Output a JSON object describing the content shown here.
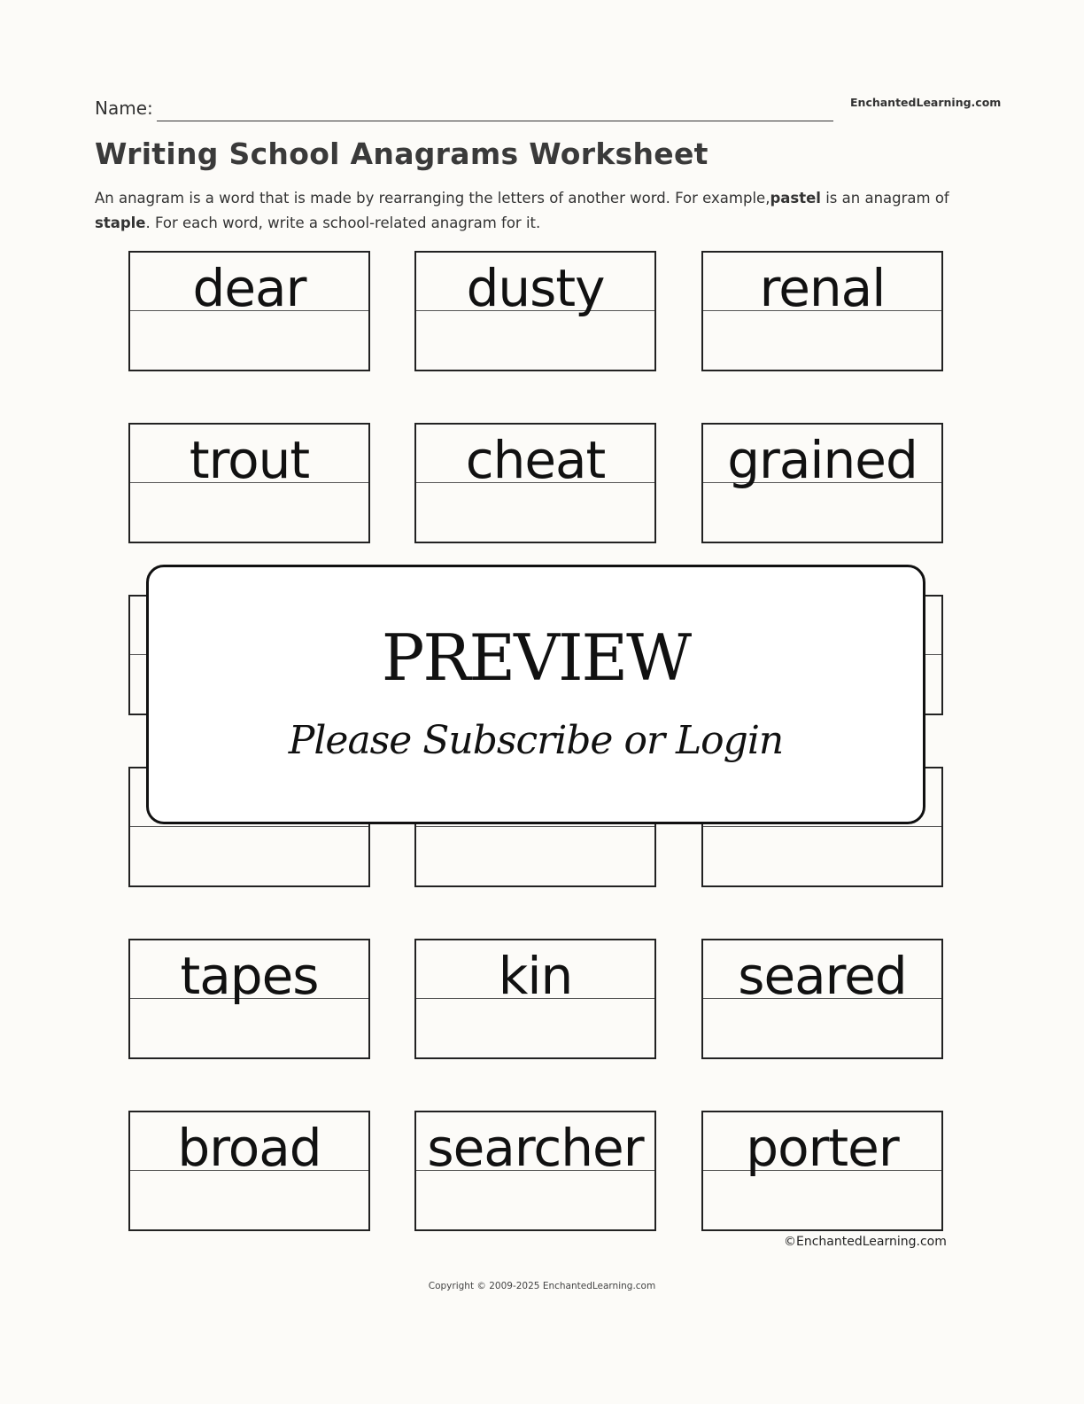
{
  "header": {
    "name_label": "Name:",
    "brand": "EnchantedLearning.com"
  },
  "title": "Writing School Anagrams Worksheet",
  "intro": {
    "part1": "An anagram is a word that is made by rearranging the letters of another word. For example,",
    "example_word": "pastel",
    "part2": " is an anagram of ",
    "example_anagram": "staple",
    "part3": ". For each word, write a school-related anagram for it."
  },
  "words": [
    {
      "word": "dear",
      "answer": ""
    },
    {
      "word": "dusty",
      "answer": ""
    },
    {
      "word": "renal",
      "answer": ""
    },
    {
      "word": "trout",
      "answer": ""
    },
    {
      "word": "cheat",
      "answer": ""
    },
    {
      "word": "grained",
      "answer": ""
    },
    {
      "word": "",
      "answer": ""
    },
    {
      "word": "",
      "answer": ""
    },
    {
      "word": "",
      "answer": ""
    },
    {
      "word": "",
      "answer": ""
    },
    {
      "word": "",
      "answer": ""
    },
    {
      "word": "",
      "answer": ""
    },
    {
      "word": "tapes",
      "answer": ""
    },
    {
      "word": "kin",
      "answer": ""
    },
    {
      "word": "seared",
      "answer": ""
    },
    {
      "word": "broad",
      "answer": ""
    },
    {
      "word": "searcher",
      "answer": ""
    },
    {
      "word": "porter",
      "answer": ""
    }
  ],
  "overlay": {
    "title": "PREVIEW",
    "subtitle": "Please Subscribe or Login"
  },
  "image_credit": "©EnchantedLearning.com",
  "footer": {
    "copyright": "Copyright © 2009-2025 EnchantedLearning.com"
  }
}
